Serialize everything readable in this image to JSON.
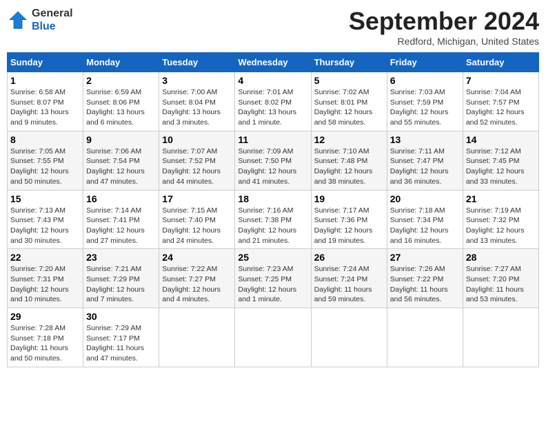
{
  "logo": {
    "line1": "General",
    "line2": "Blue"
  },
  "title": "September 2024",
  "location": "Redford, Michigan, United States",
  "weekdays": [
    "Sunday",
    "Monday",
    "Tuesday",
    "Wednesday",
    "Thursday",
    "Friday",
    "Saturday"
  ],
  "weeks": [
    [
      {
        "day": "1",
        "sunrise": "6:58 AM",
        "sunset": "8:07 PM",
        "daylight": "13 hours and 9 minutes."
      },
      {
        "day": "2",
        "sunrise": "6:59 AM",
        "sunset": "8:06 PM",
        "daylight": "13 hours and 6 minutes."
      },
      {
        "day": "3",
        "sunrise": "7:00 AM",
        "sunset": "8:04 PM",
        "daylight": "13 hours and 3 minutes."
      },
      {
        "day": "4",
        "sunrise": "7:01 AM",
        "sunset": "8:02 PM",
        "daylight": "13 hours and 1 minute."
      },
      {
        "day": "5",
        "sunrise": "7:02 AM",
        "sunset": "8:01 PM",
        "daylight": "12 hours and 58 minutes."
      },
      {
        "day": "6",
        "sunrise": "7:03 AM",
        "sunset": "7:59 PM",
        "daylight": "12 hours and 55 minutes."
      },
      {
        "day": "7",
        "sunrise": "7:04 AM",
        "sunset": "7:57 PM",
        "daylight": "12 hours and 52 minutes."
      }
    ],
    [
      {
        "day": "8",
        "sunrise": "7:05 AM",
        "sunset": "7:55 PM",
        "daylight": "12 hours and 50 minutes."
      },
      {
        "day": "9",
        "sunrise": "7:06 AM",
        "sunset": "7:54 PM",
        "daylight": "12 hours and 47 minutes."
      },
      {
        "day": "10",
        "sunrise": "7:07 AM",
        "sunset": "7:52 PM",
        "daylight": "12 hours and 44 minutes."
      },
      {
        "day": "11",
        "sunrise": "7:09 AM",
        "sunset": "7:50 PM",
        "daylight": "12 hours and 41 minutes."
      },
      {
        "day": "12",
        "sunrise": "7:10 AM",
        "sunset": "7:48 PM",
        "daylight": "12 hours and 38 minutes."
      },
      {
        "day": "13",
        "sunrise": "7:11 AM",
        "sunset": "7:47 PM",
        "daylight": "12 hours and 36 minutes."
      },
      {
        "day": "14",
        "sunrise": "7:12 AM",
        "sunset": "7:45 PM",
        "daylight": "12 hours and 33 minutes."
      }
    ],
    [
      {
        "day": "15",
        "sunrise": "7:13 AM",
        "sunset": "7:43 PM",
        "daylight": "12 hours and 30 minutes."
      },
      {
        "day": "16",
        "sunrise": "7:14 AM",
        "sunset": "7:41 PM",
        "daylight": "12 hours and 27 minutes."
      },
      {
        "day": "17",
        "sunrise": "7:15 AM",
        "sunset": "7:40 PM",
        "daylight": "12 hours and 24 minutes."
      },
      {
        "day": "18",
        "sunrise": "7:16 AM",
        "sunset": "7:38 PM",
        "daylight": "12 hours and 21 minutes."
      },
      {
        "day": "19",
        "sunrise": "7:17 AM",
        "sunset": "7:36 PM",
        "daylight": "12 hours and 19 minutes."
      },
      {
        "day": "20",
        "sunrise": "7:18 AM",
        "sunset": "7:34 PM",
        "daylight": "12 hours and 16 minutes."
      },
      {
        "day": "21",
        "sunrise": "7:19 AM",
        "sunset": "7:32 PM",
        "daylight": "12 hours and 13 minutes."
      }
    ],
    [
      {
        "day": "22",
        "sunrise": "7:20 AM",
        "sunset": "7:31 PM",
        "daylight": "12 hours and 10 minutes."
      },
      {
        "day": "23",
        "sunrise": "7:21 AM",
        "sunset": "7:29 PM",
        "daylight": "12 hours and 7 minutes."
      },
      {
        "day": "24",
        "sunrise": "7:22 AM",
        "sunset": "7:27 PM",
        "daylight": "12 hours and 4 minutes."
      },
      {
        "day": "25",
        "sunrise": "7:23 AM",
        "sunset": "7:25 PM",
        "daylight": "12 hours and 1 minute."
      },
      {
        "day": "26",
        "sunrise": "7:24 AM",
        "sunset": "7:24 PM",
        "daylight": "11 hours and 59 minutes."
      },
      {
        "day": "27",
        "sunrise": "7:26 AM",
        "sunset": "7:22 PM",
        "daylight": "11 hours and 56 minutes."
      },
      {
        "day": "28",
        "sunrise": "7:27 AM",
        "sunset": "7:20 PM",
        "daylight": "11 hours and 53 minutes."
      }
    ],
    [
      {
        "day": "29",
        "sunrise": "7:28 AM",
        "sunset": "7:18 PM",
        "daylight": "11 hours and 50 minutes."
      },
      {
        "day": "30",
        "sunrise": "7:29 AM",
        "sunset": "7:17 PM",
        "daylight": "11 hours and 47 minutes."
      },
      null,
      null,
      null,
      null,
      null
    ]
  ]
}
